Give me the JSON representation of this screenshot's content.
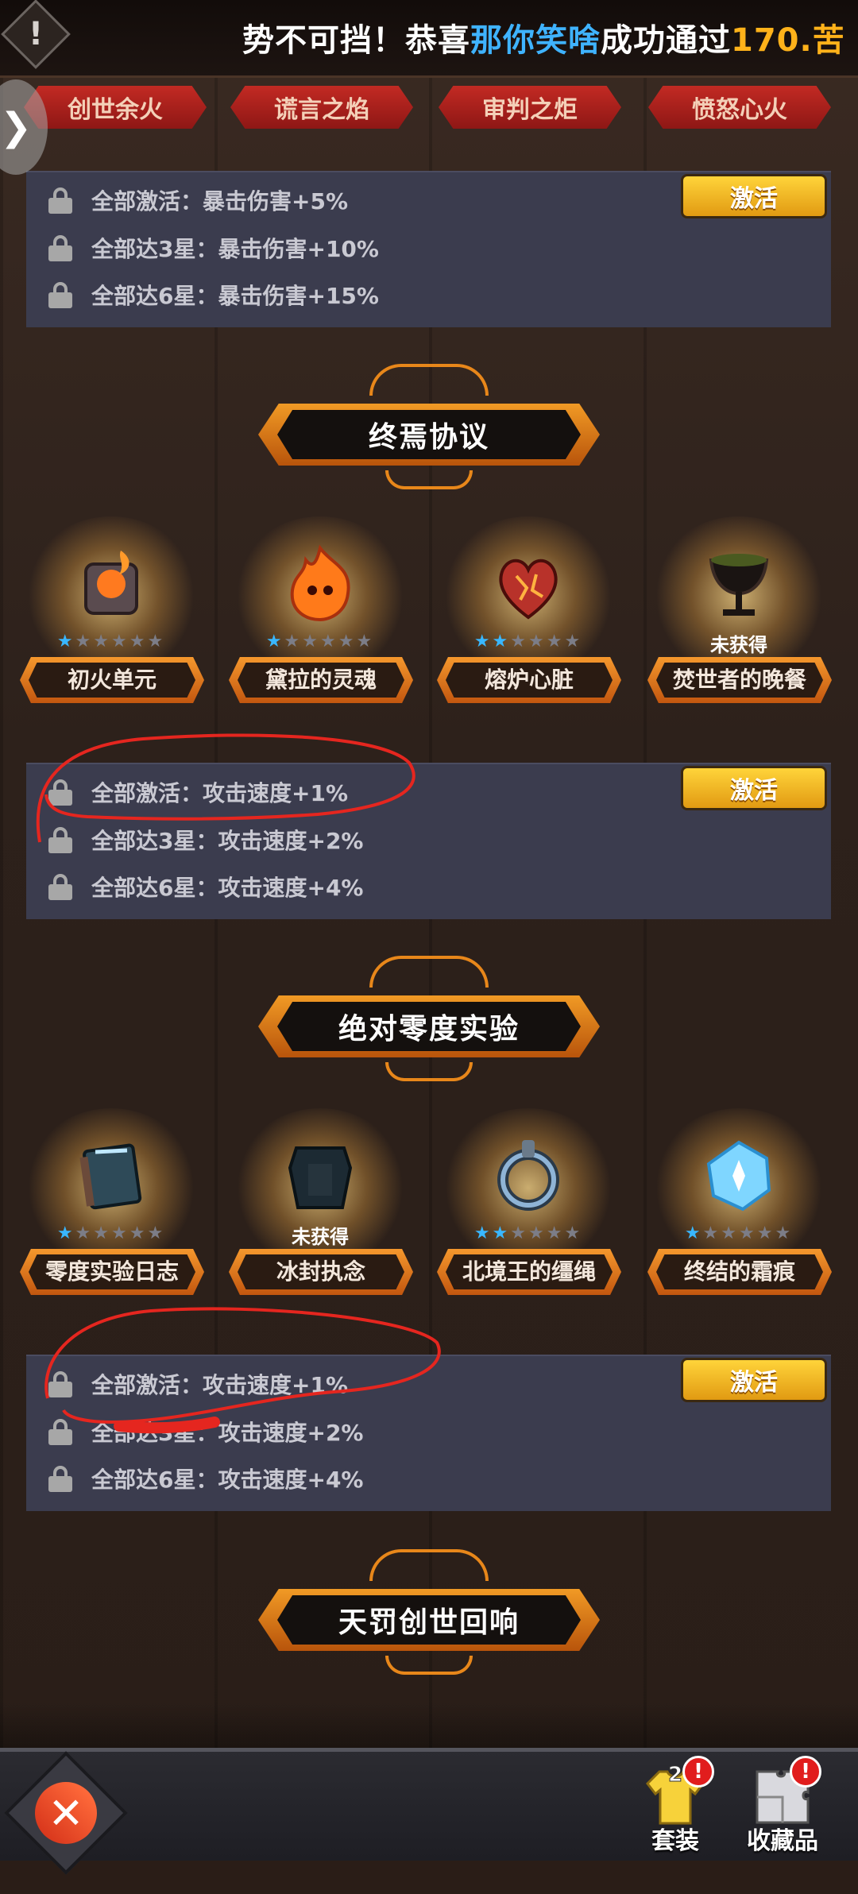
{
  "banner": {
    "warning_icon": "!",
    "text_prefix": "势不可挡！恭喜",
    "player_name": "那你笑啥",
    "text_mid": "成功通过",
    "level": "170.",
    "text_suffix": "苦"
  },
  "side_tab": {
    "icon": "chevron-left-icon",
    "glyph": "❯"
  },
  "top_ribbons": [
    "创世余火",
    "谎言之焰",
    "审判之炬",
    "愤怒心火"
  ],
  "panel_1": {
    "activate_label": "激活",
    "lines": [
      "全部激活：暴击伤害+5%",
      "全部达3星：暴击伤害+10%",
      "全部达6星：暴击伤害+15%"
    ]
  },
  "section_1": {
    "title": "终焉协议",
    "items": [
      {
        "name": "初火单元",
        "stars": 1,
        "max_stars": 6,
        "owned": true
      },
      {
        "name": "黛拉的灵魂",
        "stars": 1,
        "max_stars": 6,
        "owned": true
      },
      {
        "name": "熔炉心脏",
        "stars": 2,
        "max_stars": 6,
        "owned": true
      },
      {
        "name": "焚世者的晚餐",
        "status": "未获得",
        "owned": false
      }
    ],
    "activate_label": "激活",
    "lines": [
      "全部激活：攻击速度+1%",
      "全部达3星：攻击速度+2%",
      "全部达6星：攻击速度+4%"
    ]
  },
  "section_2": {
    "title": "绝对零度实验",
    "items": [
      {
        "name": "零度实验日志",
        "stars": 1,
        "max_stars": 6,
        "owned": true
      },
      {
        "name": "冰封执念",
        "status": "未获得",
        "owned": false
      },
      {
        "name": "北境王的缰绳",
        "stars": 2,
        "max_stars": 6,
        "owned": true
      },
      {
        "name": "终结的霜痕",
        "stars": 1,
        "max_stars": 6,
        "owned": true
      }
    ],
    "activate_label": "激活",
    "lines": [
      "全部激活：攻击速度+1%",
      "全部达3星：攻击速度+2%",
      "全部达6星：攻击速度+4%"
    ]
  },
  "section_3": {
    "title": "天罚创世回响"
  },
  "bottom_bar": {
    "close_glyph": "✕",
    "tabs": [
      {
        "label": "套装",
        "badge": "!",
        "count": "2"
      },
      {
        "label": "收藏品",
        "badge": "!"
      }
    ]
  },
  "colors": {
    "accent_orange": "#f19a25",
    "star_blue": "#39b7ff",
    "panel": "#3b3c4e",
    "ribbon_red": "#c22a23"
  }
}
